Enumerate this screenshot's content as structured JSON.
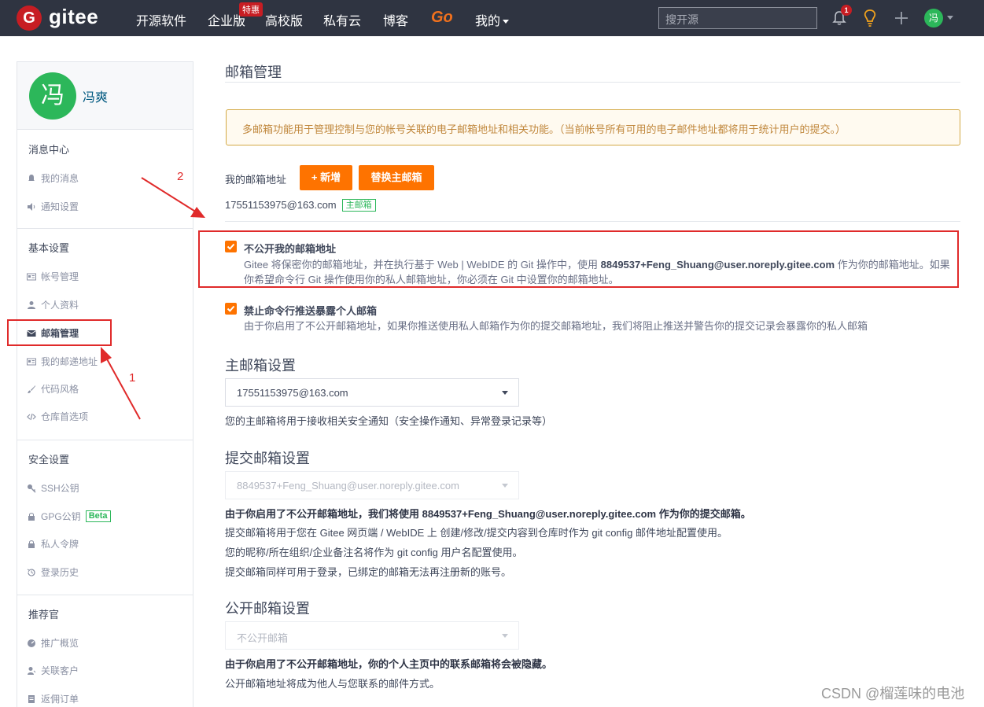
{
  "topbar": {
    "logo_letter": "G",
    "logo_text": "gitee",
    "nav": [
      "开源软件",
      "企业版",
      "高校版",
      "私有云",
      "博客",
      "我的"
    ],
    "nav_tag": "特惠",
    "go_label": "Go",
    "search_placeholder": "搜开源",
    "bell_count": "1",
    "avatar_initial": "冯"
  },
  "sidebar": {
    "avatar_initial": "冯",
    "user_name": "冯爽",
    "sections": [
      {
        "title": "消息中心",
        "items": [
          "我的消息",
          "通知设置"
        ]
      },
      {
        "title": "基本设置",
        "items": [
          "帐号管理",
          "个人资料",
          "邮箱管理",
          "我的邮递地址",
          "代码风格",
          "仓库首选项"
        ]
      },
      {
        "title": "安全设置",
        "items": [
          "SSH公钥",
          "GPG公钥",
          "私人令牌",
          "登录历史"
        ]
      },
      {
        "title": "推荐官",
        "items": [
          "推广概览",
          "关联客户",
          "返佣订单"
        ]
      }
    ],
    "beta_label": "Beta"
  },
  "main": {
    "page_title": "邮箱管理",
    "notice": "多邮箱功能用于管理控制与您的帐号关联的电子邮箱地址和相关功能。（当前帐号所有可用的电子邮件地址都将用于统计用户的提交。）",
    "my_addr_label": "我的邮箱地址",
    "add_button": "+ 新增",
    "replace_button": "替换主邮箱",
    "email": "17551153975@163.com",
    "primary_tag": "主邮箱",
    "opt1_title": "不公开我的邮箱地址",
    "opt1_desc_a": "Gitee 将保密你的邮箱地址，并在执行基于 Web | WebIDE 的 Git 操作中，使用 ",
    "opt1_desc_b": "8849537+Feng_Shuang@user.noreply.gitee.com",
    "opt1_desc_c": " 作为你的邮箱地址。如果你希望命令行 Git 操作使用你的私人邮箱地址，你必须在 Git 中设置你的邮箱地址。",
    "opt2_title": "禁止命令行推送暴露个人邮箱",
    "opt2_desc": "由于你启用了不公开邮箱地址，如果你推送使用私人邮箱作为你的提交邮箱地址，我们将阻止推送并警告你的提交记录会暴露你的私人邮箱",
    "primary_heading": "主邮箱设置",
    "primary_select": "17551153975@163.com",
    "primary_help": "您的主邮箱将用于接收相关安全通知（安全操作通知、异常登录记录等）",
    "commit_heading": "提交邮箱设置",
    "commit_select": "8849537+Feng_Shuang@user.noreply.gitee.com",
    "commit_help1": "由于你启用了不公开邮箱地址，我们将使用 8849537+Feng_Shuang@user.noreply.gitee.com 作为你的提交邮箱。",
    "commit_help2": "提交邮箱将用于您在 Gitee 网页端 / WebIDE 上 创建/修改/提交内容到仓库时作为 git config 邮件地址配置使用。",
    "commit_help3": "您的昵称/所在组织/企业备注名将作为 git config 用户名配置使用。",
    "commit_help4": "提交邮箱同样可用于登录，已绑定的邮箱无法再注册新的账号。",
    "public_heading": "公开邮箱设置",
    "public_select": "不公开邮箱",
    "public_help1": "由于你启用了不公开邮箱地址，你的个人主页中的联系邮箱将会被隐藏。",
    "public_help2": "公开邮箱地址将成为他人与您联系的邮件方式。"
  },
  "annotations": {
    "num1": "1",
    "num2": "2"
  },
  "watermark": "CSDN @榴莲味的电池",
  "colors": {
    "accent": "#fe7300",
    "nav_bg": "#2f3441",
    "brand_red": "#c71d23",
    "annotation_red": "#e02a2a",
    "green": "#2cb75a"
  }
}
